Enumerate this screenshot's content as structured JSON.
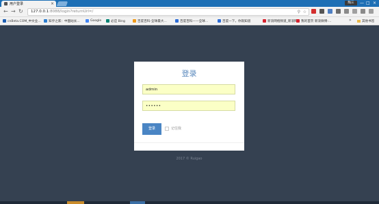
{
  "browser": {
    "tab_title": "用户登录",
    "tab_close": "×",
    "window_badge": "陶三",
    "window_controls": {
      "minimize": "—",
      "maximize": "□",
      "close": "×"
    },
    "nav_icons": [
      "back-icon",
      "forward-icon",
      "reload-icon"
    ],
    "address": {
      "host": "127.0.0.1",
      "port_path": ":8088/login?returnUrl=/"
    },
    "omnibox_icons": [
      "key-icon",
      "star-icon"
    ],
    "extension_colors": [
      "#d32f2f",
      "#555555",
      "#4e7fc3",
      "#6c6c6c",
      "#8a8a8a",
      "#a0a0a0",
      "#8a8a8a",
      "#9e9e9e"
    ]
  },
  "bookmarks": {
    "items": [
      {
        "label": "cnBeta.COM_中文业...",
        "color": "#1e5fb3"
      },
      {
        "label": "知乎之家：中国站长...",
        "color": "#2d7ed0"
      },
      {
        "label": "Google",
        "color": "#4285f4"
      },
      {
        "label": "必应 Bing",
        "color": "#008373"
      },
      {
        "label": "百度百科-全球最大...",
        "color": "#f09a1a"
      },
      {
        "label": "百度百科——全球...",
        "color": "#2e6dd6"
      },
      {
        "label": "百度一下，你就知道",
        "color": "#2e6dd6"
      },
      {
        "label": "新浪网络频道_新浪网",
        "color": "#d7232f"
      },
      {
        "label": "我的首页 新浪微博-...",
        "color": "#d7232f"
      }
    ],
    "more": "»",
    "other": "其他书签"
  },
  "login": {
    "title": "登录",
    "username": "admin",
    "password": "••••••",
    "submit_label": "登录",
    "remember_label": "记住我"
  },
  "footer": {
    "copyright": "2017 © Ruigao"
  },
  "colors": {
    "background": "#354151",
    "title_blue": "#5a89bd",
    "button_blue": "#4a85c4",
    "input_fill": "#fbffc6",
    "browser_chrome": "#1d6fb5"
  }
}
